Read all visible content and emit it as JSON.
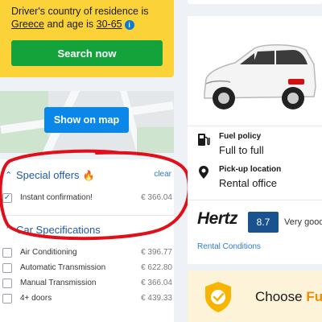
{
  "residence": {
    "prefix": "Driver's country of residence is",
    "country": "Greece",
    "middle": "and age is",
    "age": "30-65"
  },
  "search_button": "Search now",
  "map_button": "Show on map",
  "filters": {
    "special_offers": {
      "title": "Special offers",
      "clear": "clear",
      "options": [
        {
          "label": "Instant confirmation!",
          "price": "€ 366.04",
          "checked": true
        }
      ]
    },
    "car_specifications": {
      "title": "Car Specifications",
      "options": [
        {
          "label": "Air Conditioning",
          "price": "€ 396.77",
          "checked": false
        },
        {
          "label": "Automatic Transmission",
          "price": "€ 622.80",
          "checked": false
        },
        {
          "label": "Manual Transmission",
          "price": "€ 366.04",
          "checked": false
        },
        {
          "label": "4+ doors",
          "price": "€ 439.33",
          "checked": false
        }
      ]
    }
  },
  "car": {
    "fuel_policy_title": "Fuel policy",
    "fuel_policy_value": "Full to full",
    "pickup_title": "Pick-up location",
    "pickup_value": "Rental office",
    "supplier": "Hertz",
    "rating": "8.7",
    "rating_label": "Very good",
    "rental_conditions": "Rental Conditions"
  },
  "promo": {
    "choose": "Choose",
    "accent": "Fu"
  },
  "colors": {
    "yellow": "#fbd338",
    "green_button": "#14a23a",
    "blue_button": "#0a87e8",
    "rating_blue": "#19528f",
    "annotation_red": "#e0101a",
    "promo_accent": "#f28c00"
  }
}
